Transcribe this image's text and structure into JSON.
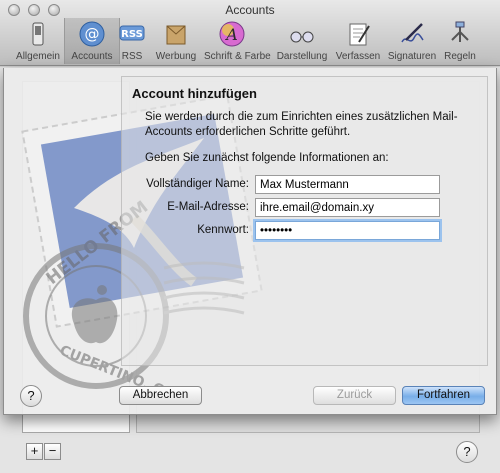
{
  "window": {
    "title": "Accounts"
  },
  "toolbar": {
    "items": [
      {
        "label": "Allgemein",
        "icon": "switch-icon"
      },
      {
        "label": "Accounts",
        "icon": "at-sign-icon"
      },
      {
        "label": "RSS",
        "icon": "rss-icon"
      },
      {
        "label": "Werbung",
        "icon": "junk-mail-icon"
      },
      {
        "label": "Schrift & Farbe",
        "icon": "font-color-icon"
      },
      {
        "label": "Darstellung",
        "icon": "glasses-icon"
      },
      {
        "label": "Verfassen",
        "icon": "compose-icon"
      },
      {
        "label": "Signaturen",
        "icon": "signature-pen-icon"
      },
      {
        "label": "Regeln",
        "icon": "rules-icon"
      }
    ],
    "rss_badge": "RSS"
  },
  "sheet": {
    "title": "Account hinzufügen",
    "intro": "Sie werden durch die zum Einrichten eines zusätzlichen Mail-Accounts erforderlichen Schritte geführt.",
    "prompt": "Geben Sie zunächst folgende Informationen an:",
    "fields": {
      "full_name": {
        "label": "Vollständiger Name:",
        "value": "Max Mustermann"
      },
      "email": {
        "label": "E-Mail-Adresse:",
        "value": "ihre.email@domain.xy"
      },
      "password": {
        "label": "Kennwort:",
        "value": "xxxxxxxx"
      }
    },
    "stamp_text": {
      "top": "HELLO FROM",
      "bottom": "CUPERTINO, CA"
    }
  },
  "buttons": {
    "help": "?",
    "cancel": "Abbrechen",
    "back": "Zurück",
    "continue": "Fortfahren"
  },
  "background": {
    "add": "+",
    "remove": "−",
    "help": "?"
  },
  "colors": {
    "default_button": "#78aee8",
    "focus_ring": "#9cc3ee"
  }
}
